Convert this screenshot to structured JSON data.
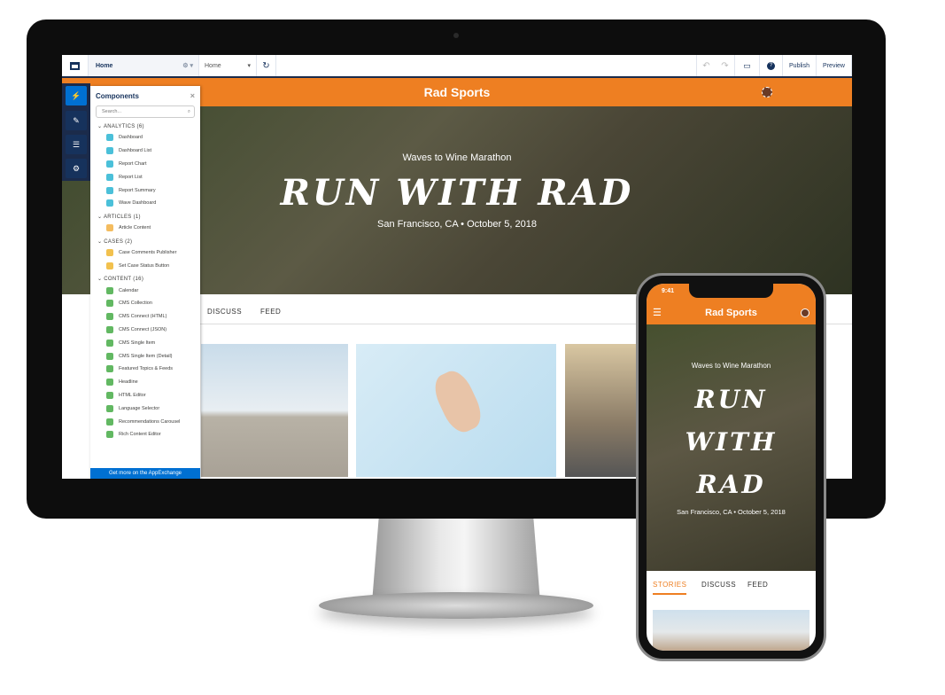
{
  "colors": {
    "brand": "#ee7f22",
    "navy": "#16325c",
    "accent": "#0070d2"
  },
  "toolbar": {
    "page": "Home",
    "page2": "Home",
    "publish": "Publish",
    "preview": "Preview"
  },
  "site": {
    "title": "Rad Sports",
    "event": "Waves to Wine Marathon",
    "headline": "RUN WITH RAD",
    "location": "San Francisco, CA • October 5, 2018"
  },
  "tabs": {
    "stories": "STORIES",
    "discuss": "DISCUSS",
    "feed": "FEED"
  },
  "panel": {
    "title": "Components",
    "search_placeholder": "Search...",
    "footer": "Get more on the AppExchange",
    "sections": [
      {
        "label": "ANALYTICS (6)",
        "color": "#4bc0d9",
        "items": [
          "Dashboard",
          "Dashboard List",
          "Report Chart",
          "Report List",
          "Report Summary",
          "Wave Dashboard"
        ]
      },
      {
        "label": "ARTICLES (1)",
        "color": "#f4bc5f",
        "items": [
          "Article Content"
        ]
      },
      {
        "label": "CASES (2)",
        "color": "#f2c14e",
        "items": [
          "Case Comments Publisher",
          "Set Case Status Button"
        ]
      },
      {
        "label": "CONTENT (16)",
        "color": "#62b862",
        "items": [
          "Calendar",
          "CMS Collection",
          "CMS Connect (HTML)",
          "CMS Connect (JSON)",
          "CMS Single Item",
          "CMS Single Item (Detail)",
          "Featured Topics & Feeds",
          "Headline",
          "HTML Editor",
          "Language Selector",
          "Recommendations Carousel",
          "Rich Content Editor"
        ]
      }
    ]
  },
  "phone": {
    "time": "9:41",
    "headline_lines": [
      "RUN",
      "WITH",
      "RAD"
    ]
  }
}
